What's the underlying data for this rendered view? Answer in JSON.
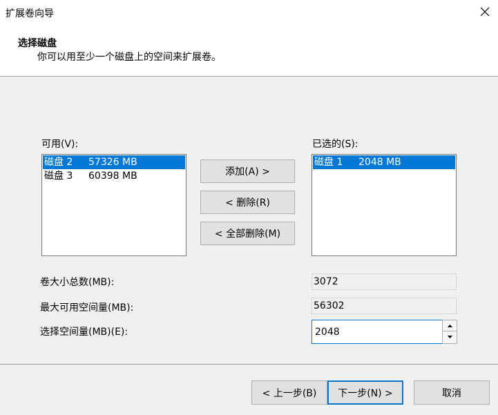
{
  "window": {
    "title": "扩展卷向导",
    "close_icon": "close-icon"
  },
  "header": {
    "title": "选择磁盘",
    "subtitle": "你可以用至少一个磁盘上的空间来扩展卷。"
  },
  "available": {
    "label": "可用(V):",
    "items": [
      {
        "name": "磁盘 2",
        "size": "57326 MB",
        "selected": true
      },
      {
        "name": "磁盘 3",
        "size": "60398 MB",
        "selected": false
      }
    ]
  },
  "selected": {
    "label": "已选的(S):",
    "items": [
      {
        "name": "磁盘 1",
        "size": "2048 MB",
        "selected": true
      }
    ]
  },
  "actions": {
    "add": "添加(A) >",
    "remove": "< 删除(R)",
    "remove_all": "< 全部删除(M)"
  },
  "fields": {
    "total_label": "卷大小总数(MB):",
    "total_value": "3072",
    "max_label": "最大可用空间量(MB):",
    "max_value": "56302",
    "select_label": "选择空间量(MB)(E):",
    "select_value": "2048"
  },
  "footer": {
    "back": "< 上一步(B)",
    "next": "下一步(N) >",
    "cancel": "取消"
  },
  "colors": {
    "accent": "#0078d7"
  }
}
